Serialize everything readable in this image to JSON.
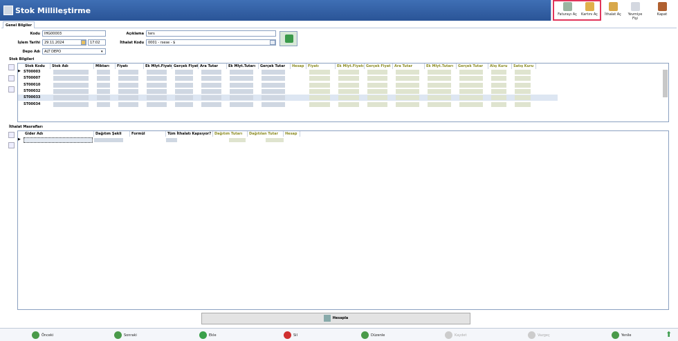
{
  "window": {
    "title": "Stok Millileştirme"
  },
  "toolbar": {
    "fatura": "Faturayı Aç",
    "karti": "Kartını Aç",
    "ithalat": "İthalat Aç",
    "yevmiye": "Yevmiye Fişi",
    "kapat": "Kapat"
  },
  "tab": "Genel Bilgiler",
  "form": {
    "kodu_label": "Kodu",
    "kodu": "IHG00003",
    "tarih_label": "İşlem Tarihi",
    "tarih": "29.11.2024",
    "saat": "17:02",
    "depo_label": "Depo Adı",
    "depo": "ALT DEPO",
    "aciklama_label": "Açıklama",
    "aciklama": "ters",
    "ithalat_label": "İthalat Kodu",
    "ithalat": "0001 - rsese - $"
  },
  "stok": {
    "section": "Stok Bilgileri",
    "headers": [
      "Stok Kodu",
      "Stok Adı",
      "Miktarı",
      "Fiyatı",
      "Ek Mlyt.Fiyatı",
      "Gerçek Fiyat",
      "Ara Tutar",
      "Ek Mlyt.Tutarı",
      "Gerçek Tutar",
      "Hesap",
      "Fiyatı",
      "Ek Mlyt.Fiyatı",
      "Gerçek Fiyat",
      "Ara Tutar",
      "Ek Mlyt.Tutarı",
      "Gerçek Tutar",
      "Alış Kuru",
      "Satış Kuru"
    ],
    "rows": [
      "ST00003",
      "ST00007",
      "ST00010",
      "ST00032",
      "ST00033",
      "ST00034"
    ]
  },
  "masraf": {
    "section": "İthalat Masrafları",
    "headers": [
      "Gider Adı",
      "Dağıtım Şekli",
      "Formül",
      "Tüm İthalatı Kapsıyor?",
      "Dağıtım Tutarı",
      "Dağıtılan Tutar",
      "Hesap"
    ]
  },
  "hesapla": "Hesapla",
  "bottom": {
    "onceki": "Önceki",
    "sonraki": "Sonraki",
    "ekle": "Ekle",
    "sil": "Sil",
    "duzenle": "Düzenle",
    "kaydet": "Kaydet",
    "vazgec": "Vazgeç",
    "yenile": "Yenile"
  }
}
